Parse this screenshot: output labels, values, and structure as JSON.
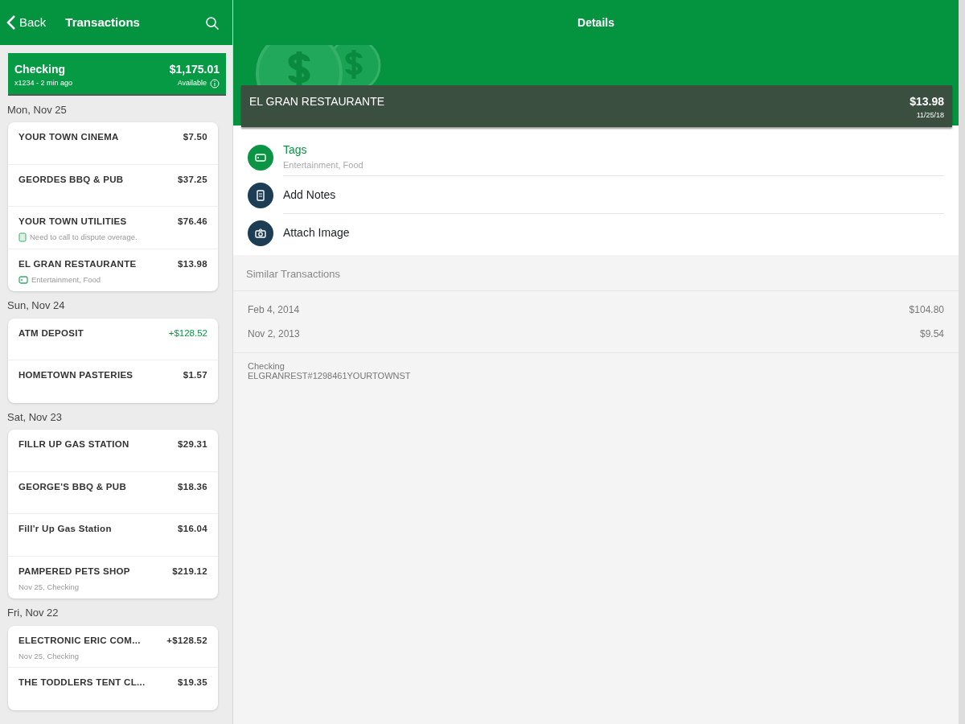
{
  "left_header": {
    "back": "Back",
    "title": "Transactions"
  },
  "account": {
    "name": "Checking",
    "balance": "$1,175.01",
    "subtitle": "x1234 - 2 min ago",
    "balance_label": "Available"
  },
  "groups": [
    {
      "date": "Mon, Nov 25",
      "transactions": [
        {
          "name": "YOUR TOWN CINEMA",
          "amount": "$7.50",
          "credit": false
        },
        {
          "name": "GEORDES BBQ & PUB",
          "amount": "$37.25",
          "credit": false
        },
        {
          "name": "YOUR TOWN UTILITIES",
          "amount": "$76.46",
          "credit": false,
          "detail": {
            "kind": "note",
            "text": "Need to call to dispute overage."
          }
        },
        {
          "name": "EL GRAN RESTAURANTE",
          "amount": "$13.98",
          "credit": false,
          "detail": {
            "kind": "tag",
            "text": "Entertainment, Food"
          }
        }
      ]
    },
    {
      "date": "Sun, Nov 24",
      "transactions": [
        {
          "name": "ATM DEPOSIT",
          "amount": "+$128.52",
          "credit": true
        },
        {
          "name": "HOMETOWN PASTERIES",
          "amount": "$1.57",
          "credit": false
        }
      ]
    },
    {
      "date": "Sat, Nov 23",
      "transactions": [
        {
          "name": "FILLR UP GAS STATION",
          "amount": "$29.31",
          "credit": false
        },
        {
          "name": "GEORGE'S BBQ & PUB",
          "amount": "$18.36",
          "credit": false
        },
        {
          "name": "Fill'r Up Gas Station",
          "amount": "$16.04",
          "credit": false
        },
        {
          "name": "PAMPERED PETS SHOP",
          "amount": "$219.12",
          "credit": false,
          "detail": {
            "kind": "plain",
            "text": "Nov 25, Checking"
          }
        }
      ]
    },
    {
      "date": "Fri, Nov 22",
      "transactions": [
        {
          "name": "ELECTRONIC ERIC COM...",
          "amount": "+$128.52",
          "credit": false,
          "detail": {
            "kind": "plain",
            "text": "Nov 25, Checking"
          }
        },
        {
          "name": "THE TODDLERS TENT CL...",
          "amount": "$19.35",
          "credit": false
        }
      ]
    }
  ],
  "details": {
    "title": "Details",
    "merchant": "EL GRAN RESTAURANTE",
    "amount": "$13.98",
    "date": "11/25/18",
    "actions": [
      {
        "kind": "tag",
        "label": "Tags",
        "subtitle": "Entertainment, Food"
      },
      {
        "kind": "notes",
        "label": "Add Notes"
      },
      {
        "kind": "camera",
        "label": "Attach Image"
      }
    ],
    "similar_title": "Similar Transactions",
    "similar": [
      {
        "date": "Feb 4, 2014",
        "amount": "$104.80"
      },
      {
        "date": "Nov 2, 2013",
        "amount": "$9.54"
      }
    ],
    "account": "Checking",
    "description": "ELGRANREST#1298461YOURTOWNST"
  }
}
